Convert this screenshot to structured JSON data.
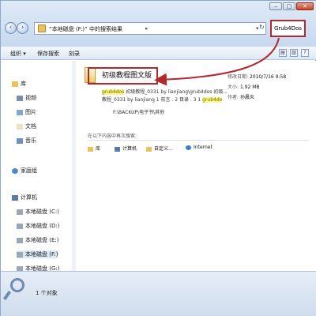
{
  "window": {
    "min_label": "–",
    "max_label": "□",
    "close_label": "✕"
  },
  "address": {
    "breadcrumb_1": "“本地磁盘 (F:)” 中的搜索结果",
    "sep": "▸",
    "dropdown": "▾",
    "refresh": "↻"
  },
  "search": {
    "value": "Grub4Dos",
    "clear": "✕"
  },
  "toolbar": {
    "organize": "组织 ▾",
    "save_search": "保存搜索",
    "burn": "刻录"
  },
  "sidebar": {
    "items": [
      {
        "label": "库"
      },
      {
        "label": "视频"
      },
      {
        "label": "图片"
      },
      {
        "label": "文档"
      },
      {
        "label": "音乐"
      },
      {
        "label": "家庭组"
      },
      {
        "label": "计算机"
      },
      {
        "label": "本地磁盘 (C:)"
      },
      {
        "label": "本地磁盘 (D:)"
      },
      {
        "label": "本地磁盘 (E:)"
      },
      {
        "label": "本地磁盘 (F:)"
      },
      {
        "label": "本地磁盘 (G:)"
      }
    ]
  },
  "result": {
    "title": "初级教程图文版",
    "line1_hl": "grub4dos",
    "line1_rest": " 初级教程_0331 by lianjiang\\grub4dos 初级...",
    "line2_a": "教程_0331 by lianjiang 1 前言 . 2 目录 . 3 1 ",
    "line2_hl": "grub4do",
    "line3": "F:\\BACKUP\\电子书\\其他",
    "modified_label": "修改日期:",
    "modified_value": "2010/7/16 9:58",
    "size_label": "大小:",
    "size_value": "1.92 MB",
    "author_label": "作者:",
    "author_value": "孙晨炎"
  },
  "search_again": {
    "label": "在以下内容中再次搜索:",
    "items": [
      "库",
      "计算机",
      "自定义...",
      "Internet"
    ]
  },
  "status": {
    "text": "1 个对象"
  },
  "colors": {
    "highlight_box": "#b3282d",
    "folder": "#e9c25a",
    "accent": "#2a5590"
  }
}
